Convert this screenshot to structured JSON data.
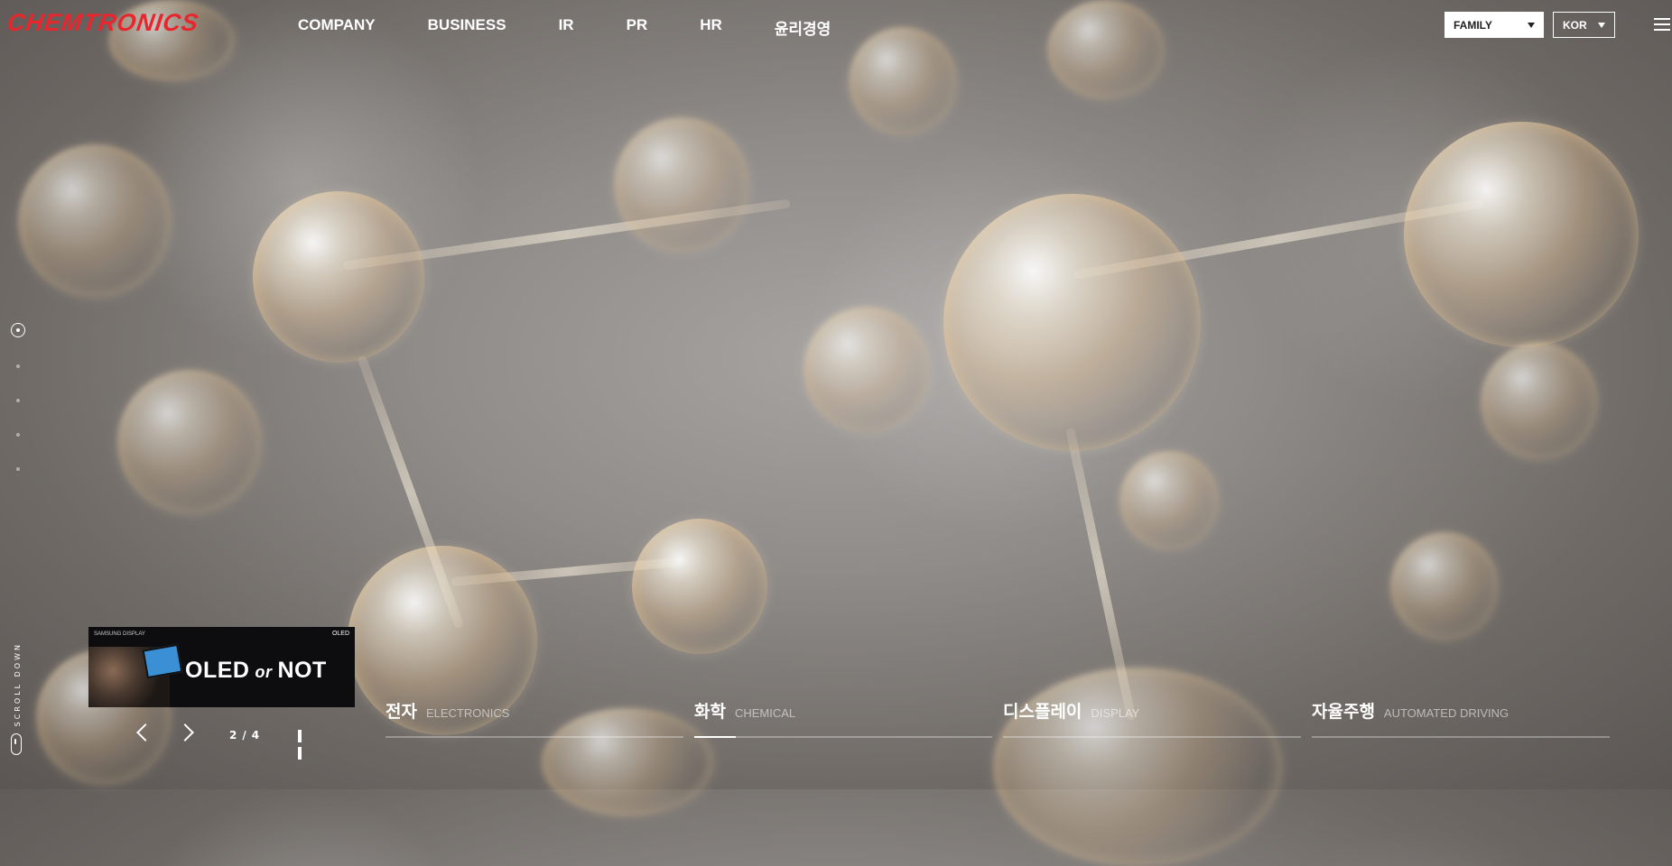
{
  "header": {
    "logo": "CHEMTRONICS",
    "nav": [
      "COMPANY",
      "BUSINESS",
      "IR",
      "PR",
      "HR",
      "윤리경영"
    ],
    "family_select": "FAMILY",
    "language_select": "KOR"
  },
  "side_pager": {
    "count": 5,
    "active_index": 0
  },
  "scroll_down": "SCROLL DOWN",
  "thumbnail": {
    "brand": "SAMSUNG DISPLAY",
    "mark": "OLED",
    "title_left": "OLED",
    "title_mid": "or",
    "title_right": "NOT"
  },
  "slider": {
    "current": "2",
    "separator": "/",
    "total": "4"
  },
  "business_tabs": [
    {
      "ko": "전자",
      "en": "ELECTRONICS",
      "active": false,
      "progress": 0
    },
    {
      "ko": "화학",
      "en": "CHEMICAL",
      "active": true,
      "progress": 0.14
    },
    {
      "ko": "디스플레이",
      "en": "DISPLAY",
      "active": false,
      "progress": 0
    },
    {
      "ko": "자율주행",
      "en": "AUTOMATED DRIVING",
      "active": false,
      "progress": 0
    }
  ],
  "colors": {
    "brand_red": "#e8262d",
    "text": "#ffffff",
    "background": "#8f8b88"
  },
  "icons": {
    "menu": "hamburger-icon",
    "prev": "chevron-left-icon",
    "next": "chevron-right-icon",
    "pause": "pause-icon",
    "mouse": "mouse-icon"
  }
}
